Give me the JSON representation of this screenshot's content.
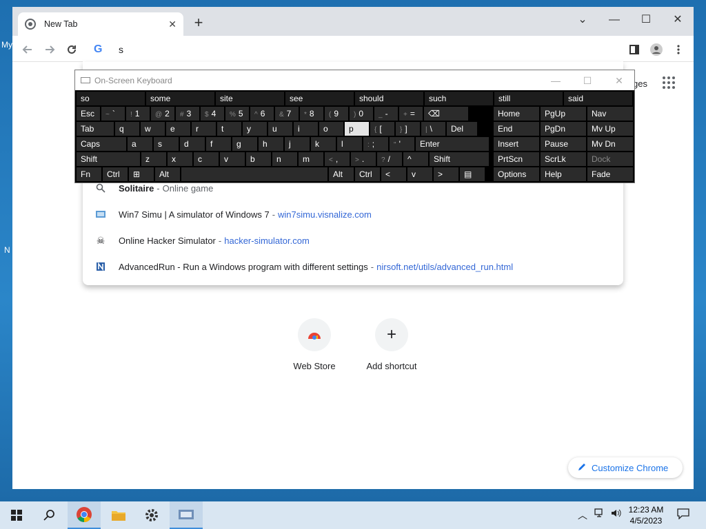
{
  "desktop": {
    "labels": [
      "My",
      "N"
    ]
  },
  "browser": {
    "tab_title": "New Tab",
    "omnibox_text": "s",
    "images_link": "ges",
    "suggestions": [
      {
        "icon": "search-icon",
        "bold": "S",
        "main_rest": "olitaire",
        "sep": "-",
        "sub": "Online game",
        "url": ""
      },
      {
        "icon": "win7-icon",
        "main": "Win7 Simu | A simulator of Windows 7",
        "sep": "-",
        "url": "win7simu.visnalize.com"
      },
      {
        "icon": "skull-icon",
        "main": "Online Hacker Simulator",
        "sep": "-",
        "url": "hacker-simulator.com"
      },
      {
        "icon": "advancedrun-icon",
        "main": "AdvancedRun - Run a Windows program with different settings",
        "sep": "-",
        "url": "nirsoft.net/utils/advanced_run.html"
      }
    ],
    "shortcuts": [
      {
        "label": "Web Store"
      },
      {
        "label": "Add shortcut"
      }
    ],
    "customize_label": "Customize Chrome"
  },
  "osk": {
    "title": "On-Screen Keyboard",
    "predictions": [
      "so",
      "some",
      "site",
      "see",
      "should",
      "such",
      "still",
      "said"
    ],
    "row1": [
      {
        "label": "Esc"
      },
      {
        "shift": "~",
        "label": "`"
      },
      {
        "shift": "!",
        "label": "1"
      },
      {
        "shift": "@",
        "label": "2"
      },
      {
        "shift": "#",
        "label": "3"
      },
      {
        "shift": "$",
        "label": "4"
      },
      {
        "shift": "%",
        "label": "5"
      },
      {
        "shift": "^",
        "label": "6"
      },
      {
        "shift": "&",
        "label": "7"
      },
      {
        "shift": "*",
        "label": "8"
      },
      {
        "shift": "(",
        "label": "9"
      },
      {
        "shift": ")",
        "label": "0"
      },
      {
        "shift": "_",
        "label": "-"
      },
      {
        "shift": "+",
        "label": "="
      },
      {
        "label": "⌫"
      }
    ],
    "row2": [
      {
        "label": "Tab"
      },
      {
        "label": "q"
      },
      {
        "label": "w"
      },
      {
        "label": "e"
      },
      {
        "label": "r"
      },
      {
        "label": "t"
      },
      {
        "label": "y"
      },
      {
        "label": "u"
      },
      {
        "label": "i"
      },
      {
        "label": "o"
      },
      {
        "label": "p"
      },
      {
        "shift": "{",
        "label": "["
      },
      {
        "shift": "}",
        "label": "]"
      },
      {
        "shift": "|",
        "label": "\\"
      },
      {
        "label": "Del"
      }
    ],
    "row3": [
      {
        "label": "Caps"
      },
      {
        "label": "a"
      },
      {
        "label": "s"
      },
      {
        "label": "d"
      },
      {
        "label": "f"
      },
      {
        "label": "g"
      },
      {
        "label": "h"
      },
      {
        "label": "j"
      },
      {
        "label": "k"
      },
      {
        "label": "l"
      },
      {
        "shift": ":",
        "label": ";"
      },
      {
        "shift": "\"",
        "label": "'"
      },
      {
        "label": "Enter"
      }
    ],
    "row4": [
      {
        "label": "Shift"
      },
      {
        "label": "z"
      },
      {
        "label": "x"
      },
      {
        "label": "c"
      },
      {
        "label": "v"
      },
      {
        "label": "b"
      },
      {
        "label": "n"
      },
      {
        "label": "m"
      },
      {
        "shift": "<",
        "label": ","
      },
      {
        "shift": ">",
        "label": "."
      },
      {
        "shift": "?",
        "label": "/"
      },
      {
        "label": "^"
      },
      {
        "label": "Shift"
      }
    ],
    "row5": [
      {
        "label": "Fn"
      },
      {
        "label": "Ctrl"
      },
      {
        "label": "⊞"
      },
      {
        "label": "Alt"
      },
      {
        "label": ""
      },
      {
        "label": "Alt"
      },
      {
        "label": "Ctrl"
      },
      {
        "label": "<"
      },
      {
        "label": "v"
      },
      {
        "label": ">"
      },
      {
        "label": "▤"
      }
    ],
    "right": [
      [
        "Home",
        "PgUp",
        "Nav"
      ],
      [
        "End",
        "PgDn",
        "Mv Up"
      ],
      [
        "Insert",
        "Pause",
        "Mv Dn"
      ],
      [
        "PrtScn",
        "ScrLk",
        "Dock"
      ],
      [
        "Options",
        "Help",
        "Fade"
      ]
    ]
  },
  "taskbar": {
    "time": "12:23 AM",
    "date": "4/5/2023"
  }
}
